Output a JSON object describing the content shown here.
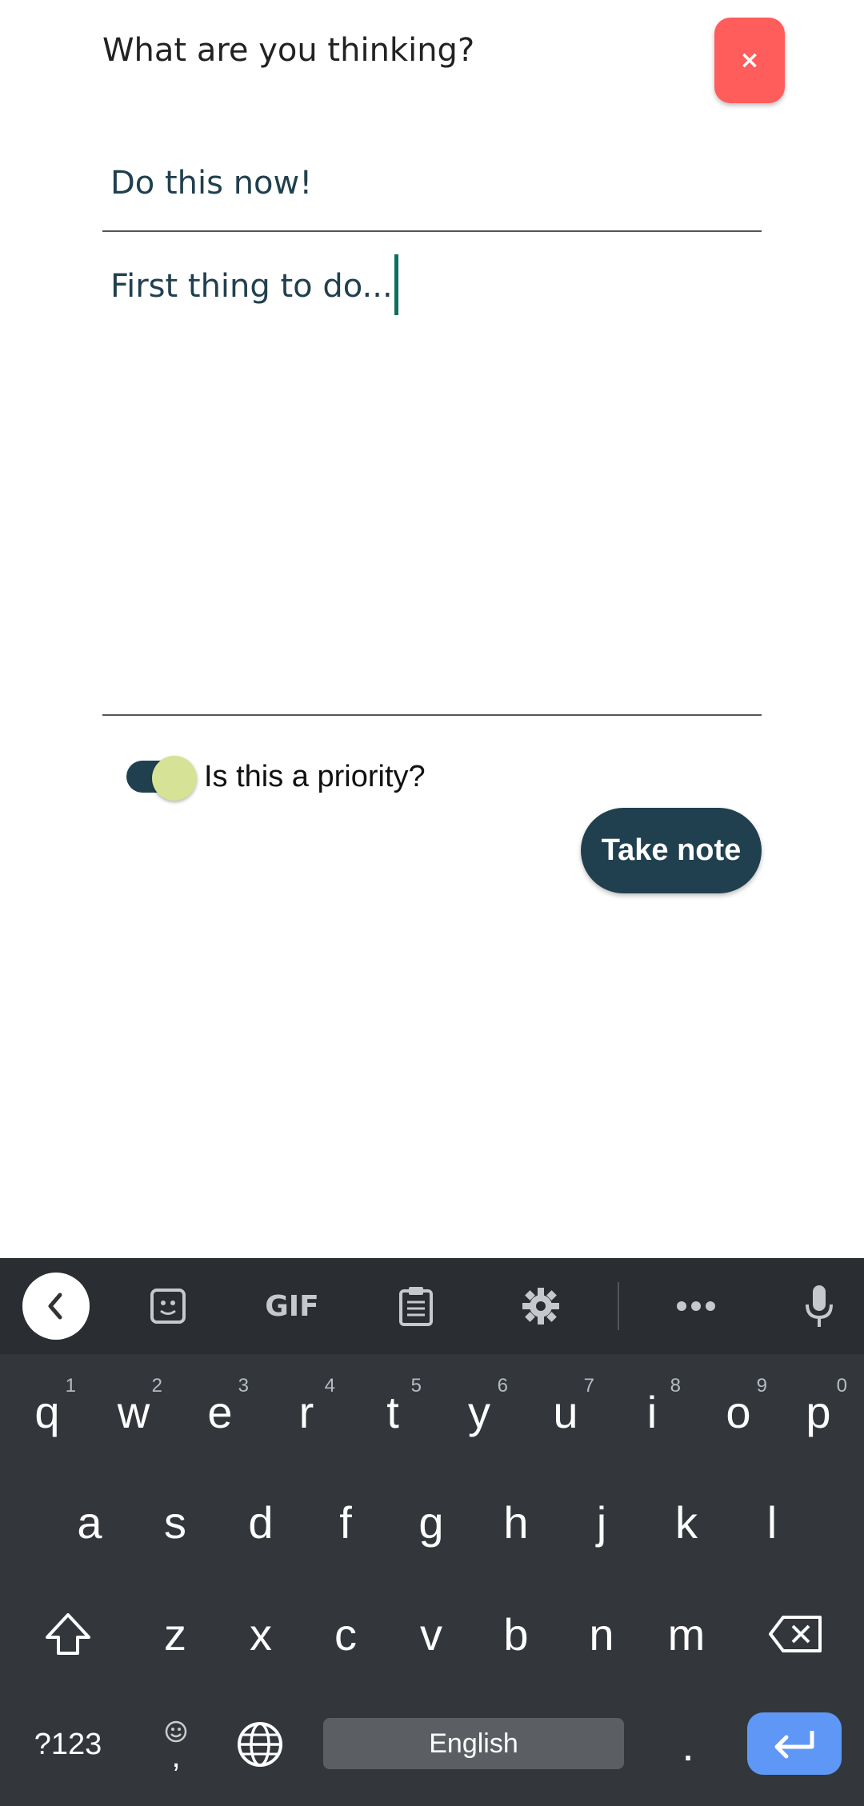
{
  "form": {
    "heading": "What are you thinking?",
    "close_label": "×",
    "title_value": "Do this now!",
    "body_value": "First thing to do...",
    "priority_label": "Is this a priority?",
    "priority_on": true,
    "submit_label": "Take note"
  },
  "keyboard": {
    "row1": [
      {
        "key": "q",
        "hint": "1"
      },
      {
        "key": "w",
        "hint": "2"
      },
      {
        "key": "e",
        "hint": "3"
      },
      {
        "key": "r",
        "hint": "4"
      },
      {
        "key": "t",
        "hint": "5"
      },
      {
        "key": "y",
        "hint": "6"
      },
      {
        "key": "u",
        "hint": "7"
      },
      {
        "key": "i",
        "hint": "8"
      },
      {
        "key": "o",
        "hint": "9"
      },
      {
        "key": "p",
        "hint": "0"
      }
    ],
    "row2": [
      "a",
      "s",
      "d",
      "f",
      "g",
      "h",
      "j",
      "k",
      "l"
    ],
    "row3": [
      "z",
      "x",
      "c",
      "v",
      "b",
      "n",
      "m"
    ],
    "symbols_label": "?123",
    "comma_label": ",",
    "space_label": "English",
    "period_label": ".",
    "toolbar_gif": "GIF"
  },
  "colors": {
    "accent": "#21404f",
    "close": "#ff5c5c",
    "toggle_knob": "#d6e295",
    "enter": "#5e97f6"
  }
}
